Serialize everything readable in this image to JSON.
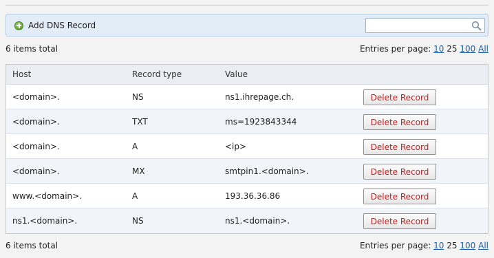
{
  "toolbar": {
    "add_label": "Add DNS Record",
    "search_value": "",
    "search_placeholder": ""
  },
  "summary_top": {
    "total_text": "6 items total",
    "entries_label": "Entries per page:",
    "options": [
      "10",
      "25",
      "100",
      "All"
    ],
    "current": "25"
  },
  "summary_bottom": {
    "total_text": "6 items total",
    "entries_label": "Entries per page:",
    "options": [
      "10",
      "25",
      "100",
      "All"
    ],
    "current": "25"
  },
  "table": {
    "columns": [
      "Host",
      "Record type",
      "Value"
    ],
    "rows": [
      {
        "host": "<domain>.",
        "type": "NS",
        "value": "ns1.ihrepage.ch.",
        "action": "Delete Record"
      },
      {
        "host": "<domain>.",
        "type": "TXT",
        "value": "ms=1923843344",
        "action": "Delete Record"
      },
      {
        "host": "<domain>.",
        "type": "A",
        "value": "<ip>",
        "action": "Delete Record"
      },
      {
        "host": "<domain>.",
        "type": "MX",
        "value": "smtpin1.<domain>.",
        "action": "Delete Record"
      },
      {
        "host": "www.<domain>.",
        "type": "A",
        "value": "193.36.36.86",
        "action": "Delete Record"
      },
      {
        "host": "ns1.<domain>.",
        "type": "NS",
        "value": "ns1.<domain>.",
        "action": "Delete Record"
      }
    ]
  },
  "colors": {
    "accent_link": "#1f5fa8",
    "delete_text": "#d11b1b",
    "toolbar_bg": "#e1ecf7"
  },
  "icons": {
    "add": "add-circle-icon",
    "search": "search-icon"
  }
}
